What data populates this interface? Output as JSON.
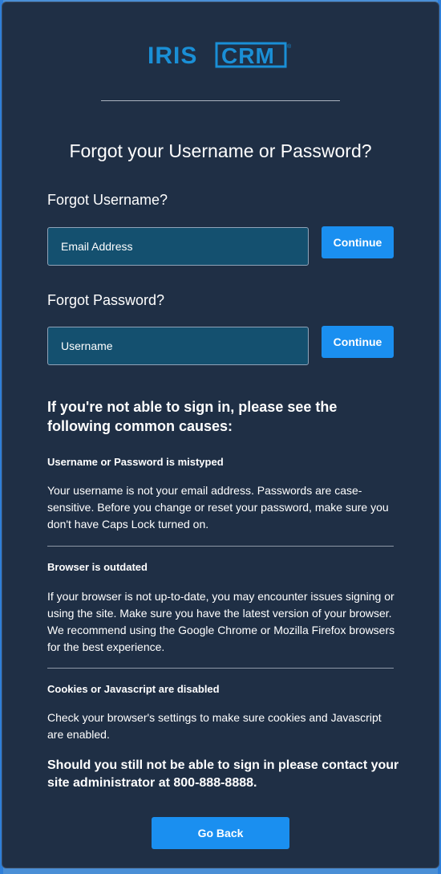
{
  "logo": {
    "part1": "IRIS",
    "part2": "CRM",
    "reg": "®"
  },
  "title": "Forgot your Username or Password?",
  "forgot_username": {
    "heading": "Forgot Username?",
    "placeholder": "Email Address",
    "button": "Continue"
  },
  "forgot_password": {
    "heading": "Forgot Password?",
    "placeholder": "Username",
    "button": "Continue"
  },
  "causes": {
    "heading": "If you're not able to sign in, please see the following common causes:",
    "items": [
      {
        "title": "Username or Password is mistyped",
        "body": "Your username is not your email address. Passwords are case-sensitive. Before you change or reset your password, make sure you don't have Caps Lock turned on."
      },
      {
        "title": "Browser is outdated",
        "body": "If your browser is not up-to-date, you may encounter issues signing or using the site. Make sure you have the latest version of your browser. We recommend using the Google Chrome or Mozilla Firefox browsers for the best experience."
      },
      {
        "title": "Cookies or Javascript are disabled",
        "body": "Check your browser's settings to make sure cookies and Javascript are enabled."
      }
    ]
  },
  "contact": "Should you still not be able to sign in please contact your site administrator at 800-888-8888.",
  "go_back": "Go Back",
  "colors": {
    "panel": "#1f2f45",
    "accent": "#1a8ff0",
    "input": "#14506f",
    "logo": "#1a8fd6"
  }
}
